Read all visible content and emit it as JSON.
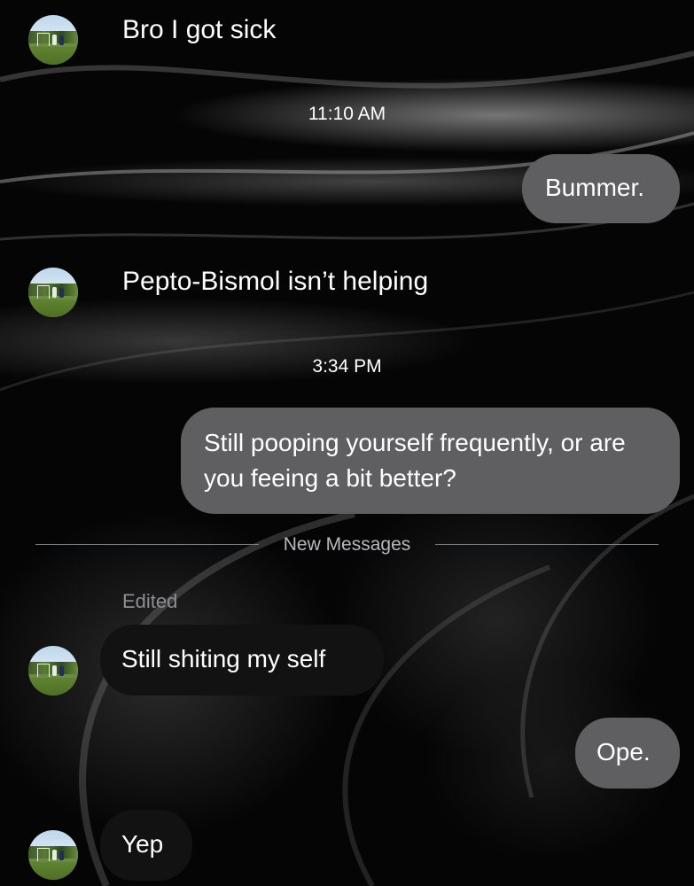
{
  "conversation": {
    "messages": [
      {
        "direction": "incoming",
        "text": "Bro I got sick"
      },
      {
        "type": "timestamp",
        "text": "11:10 AM"
      },
      {
        "direction": "outgoing",
        "text": "Bummer."
      },
      {
        "direction": "incoming",
        "text": "Pepto-Bismol isn’t helping"
      },
      {
        "type": "timestamp",
        "text": "3:34 PM"
      },
      {
        "direction": "outgoing",
        "text": "Still pooping yourself frequently, or are you feeing a bit better?"
      },
      {
        "type": "divider",
        "text": "New Messages"
      },
      {
        "type": "edited_label",
        "text": "Edited"
      },
      {
        "direction": "incoming",
        "text": "Still shiting my self"
      },
      {
        "direction": "outgoing",
        "text": "Ope."
      },
      {
        "direction": "incoming",
        "text": "Yep"
      }
    ]
  },
  "colors": {
    "outgoing_bubble": "#5f5f61",
    "incoming_bubble": "#121212",
    "background": "#050505",
    "divider": "#7d8287",
    "edited_label": "#8e8e93"
  },
  "icons": {
    "avatar": "contact-avatar-photo"
  }
}
